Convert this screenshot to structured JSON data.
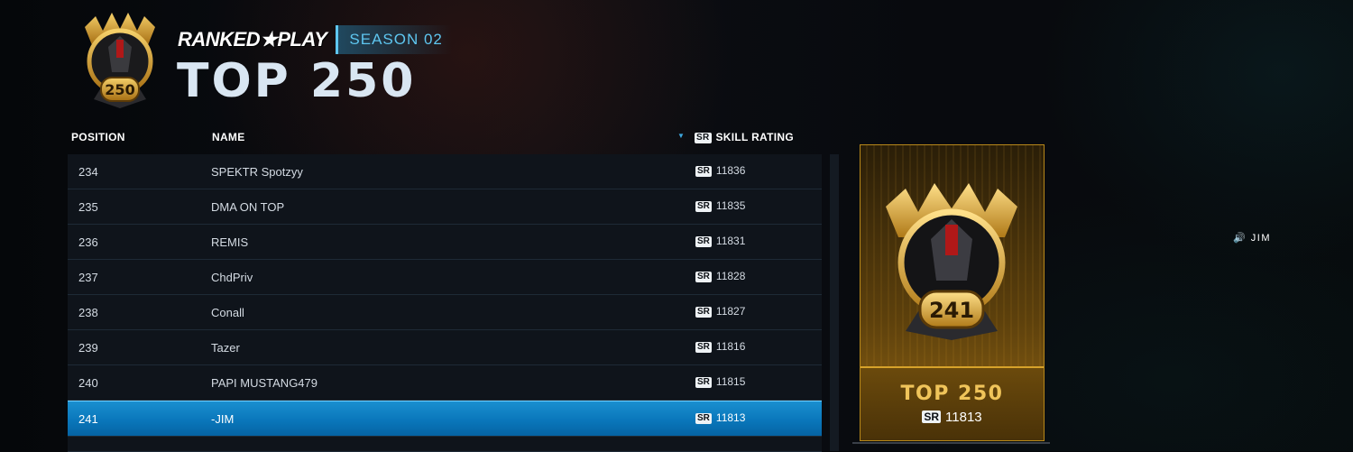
{
  "header": {
    "mode_label": "RANKED★PLAY",
    "season_label": "SEASON 02",
    "title": "TOP 250",
    "emblem_number": "250"
  },
  "columns": {
    "position": "POSITION",
    "name": "NAME",
    "sr_badge": "SR",
    "skill_rating": "SKILL RATING"
  },
  "rows": [
    {
      "position": "234",
      "name": "SPEKTR Spotzyy",
      "sr_badge": "SR",
      "rating": "11836"
    },
    {
      "position": "235",
      "name": "DMA ON TOP",
      "sr_badge": "SR",
      "rating": "11835"
    },
    {
      "position": "236",
      "name": "REMIS",
      "sr_badge": "SR",
      "rating": "11831"
    },
    {
      "position": "237",
      "name": "ChdPriv",
      "sr_badge": "SR",
      "rating": "11828"
    },
    {
      "position": "238",
      "name": "Conall",
      "sr_badge": "SR",
      "rating": "11827"
    },
    {
      "position": "239",
      "name": "Tazer",
      "sr_badge": "SR",
      "rating": "11816"
    },
    {
      "position": "240",
      "name": "PAPI MUSTANG479",
      "sr_badge": "SR",
      "rating": "11815"
    },
    {
      "position": "241",
      "name": "-JIM",
      "sr_badge": "SR",
      "rating": "11813",
      "highlighted": true
    }
  ],
  "card": {
    "emblem_number": "241",
    "title": "TOP 250",
    "sr_badge": "SR",
    "rating": "11813"
  },
  "voice": {
    "icon": "speaker-icon",
    "name": "JIM"
  },
  "colors": {
    "accent_blue": "#0a77bb",
    "gold": "#f0c45a"
  }
}
